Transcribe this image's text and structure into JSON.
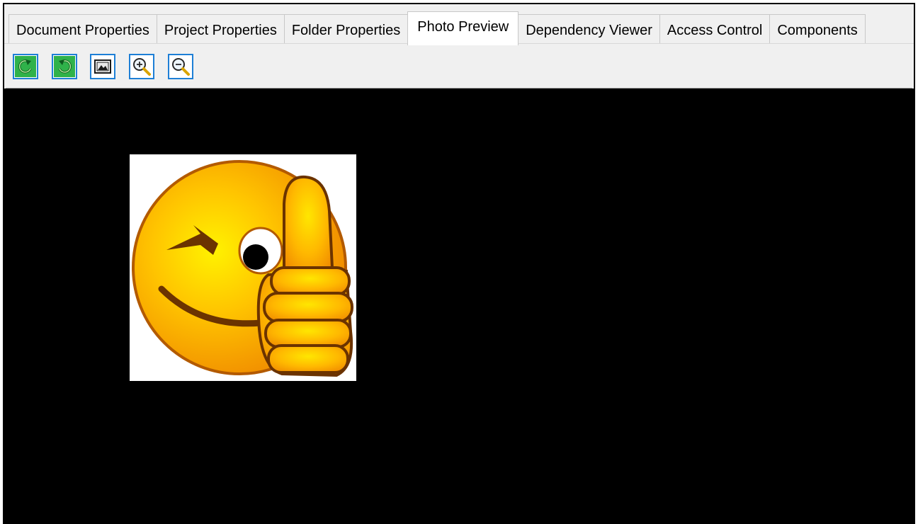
{
  "tabs": [
    {
      "label": "Document Properties",
      "active": false
    },
    {
      "label": "Project Properties",
      "active": false
    },
    {
      "label": "Folder Properties",
      "active": false
    },
    {
      "label": "Photo Preview",
      "active": true
    },
    {
      "label": "Dependency Viewer",
      "active": false
    },
    {
      "label": "Access Control",
      "active": false
    },
    {
      "label": "Components",
      "active": false
    }
  ],
  "toolbar": {
    "buttons": [
      {
        "icon": "rotate-left-icon"
      },
      {
        "icon": "rotate-right-icon"
      },
      {
        "icon": "fit-image-icon"
      },
      {
        "icon": "zoom-in-icon"
      },
      {
        "icon": "zoom-out-icon"
      }
    ]
  },
  "preview": {
    "background": "#000000",
    "image": "winking-smiley-thumbs-up"
  },
  "colors": {
    "accent": "#1e7fd6",
    "smiley": "#ffb000",
    "outline": "#b35a00",
    "brow": "#6b3300"
  }
}
